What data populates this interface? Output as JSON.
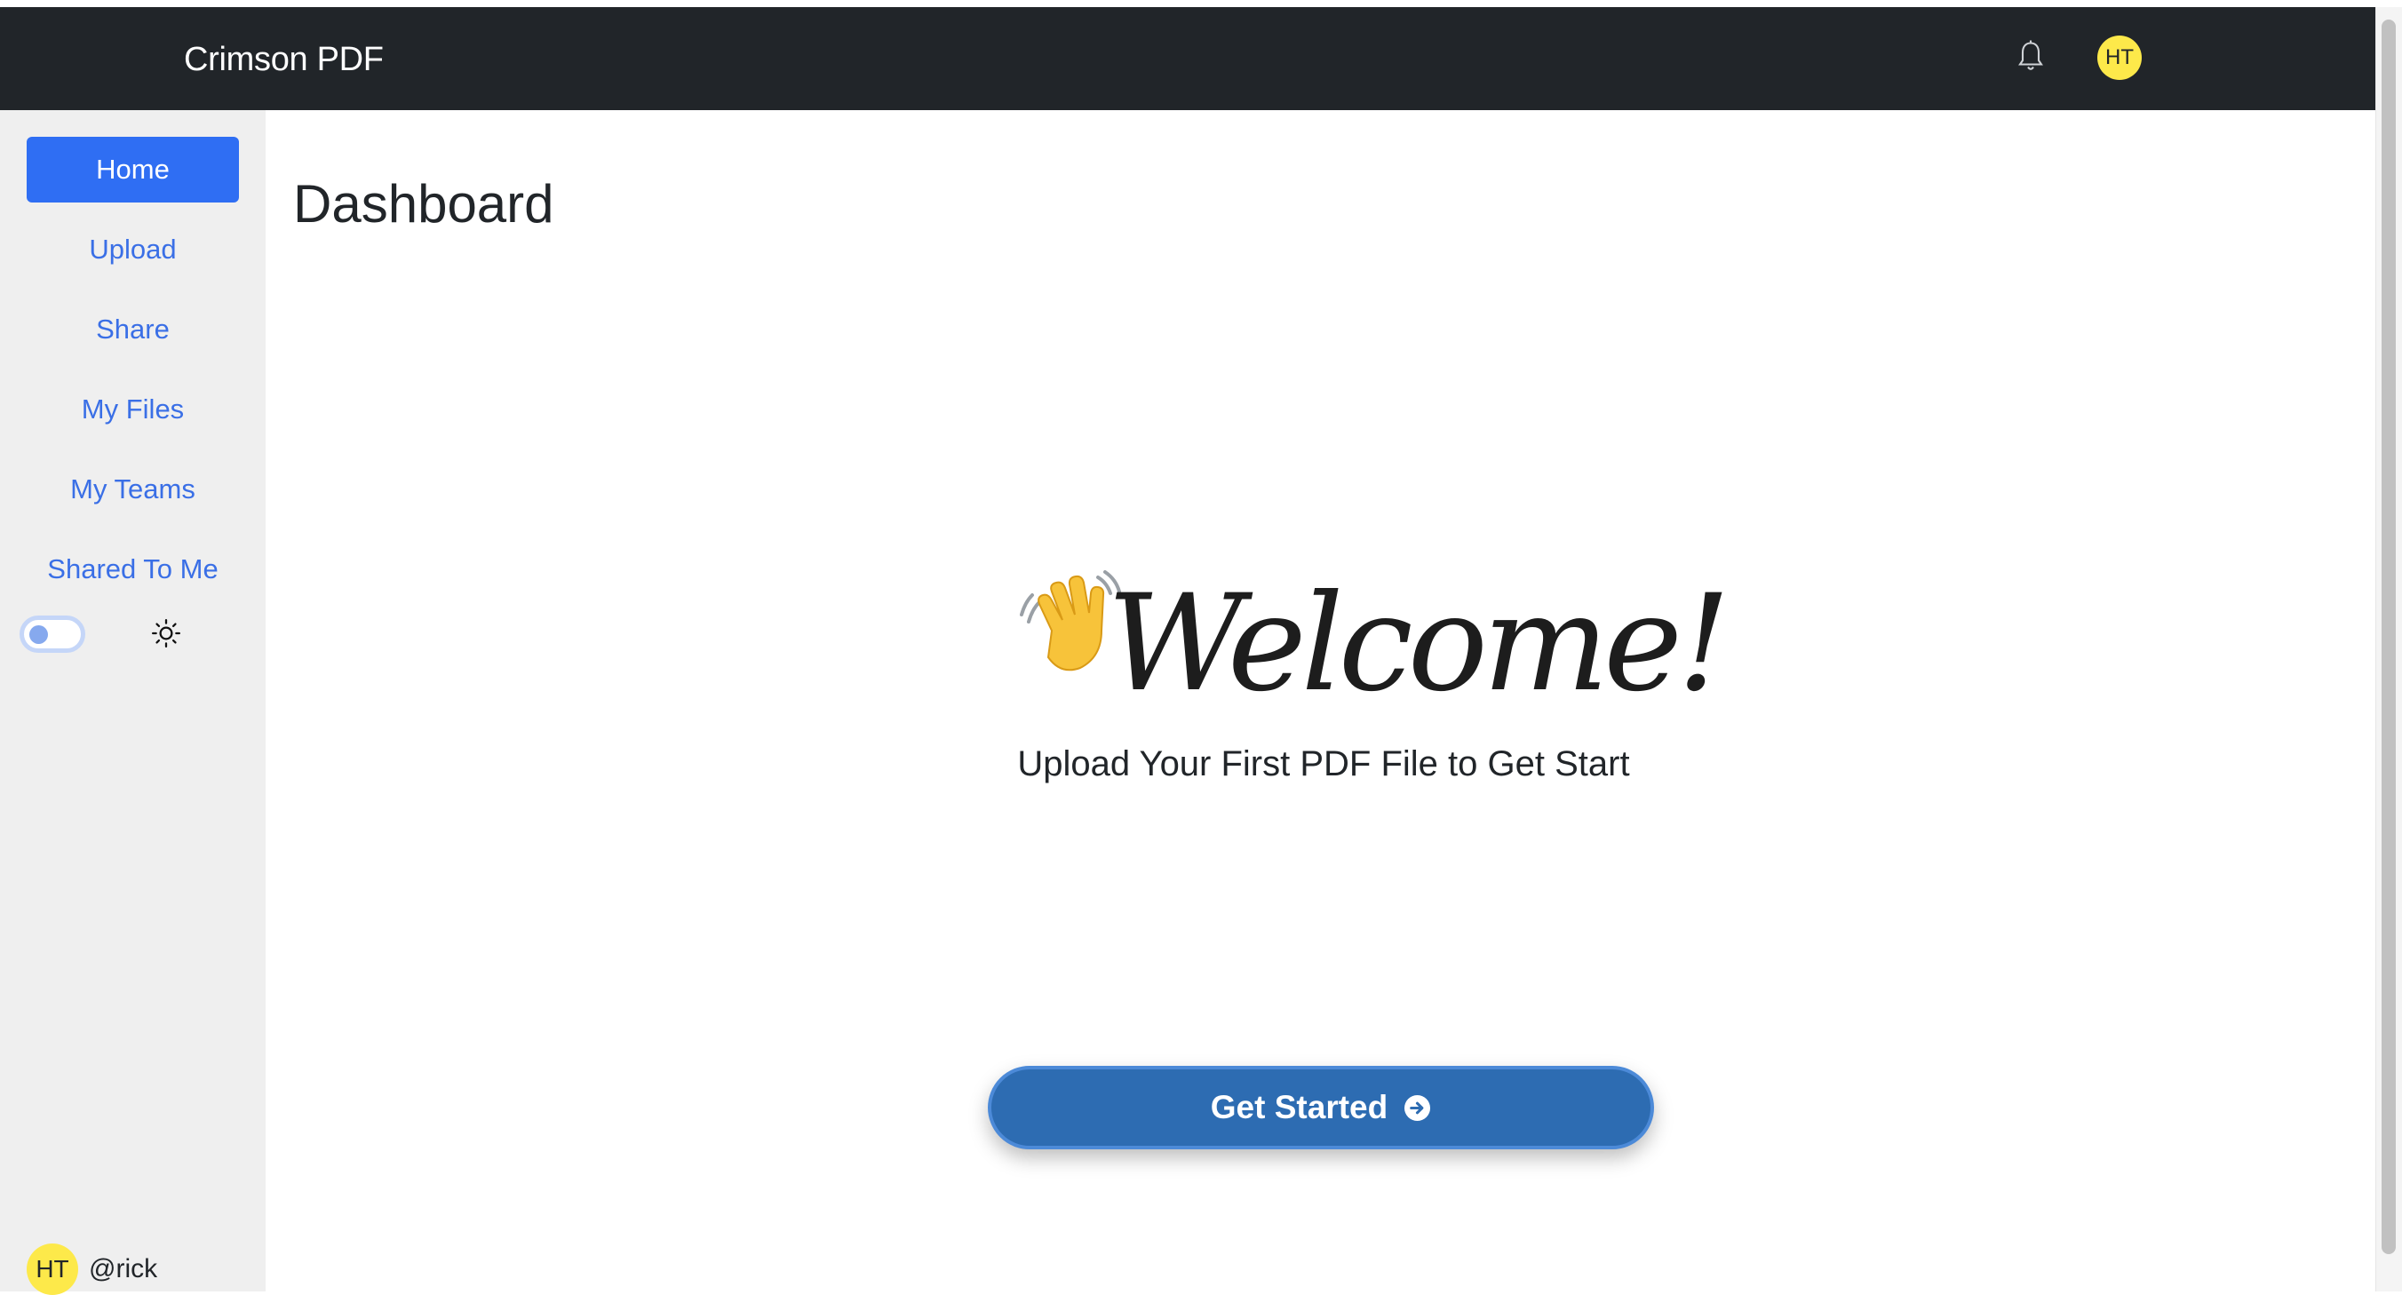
{
  "navbar": {
    "brand": "Crimson PDF",
    "bell_icon": "bell-icon",
    "avatar_initials": "HT"
  },
  "sidebar": {
    "items": [
      {
        "label": "Home",
        "active": true
      },
      {
        "label": "Upload",
        "active": false
      },
      {
        "label": "Share",
        "active": false
      },
      {
        "label": "My Files",
        "active": false
      },
      {
        "label": "My Teams",
        "active": false
      },
      {
        "label": "Shared To Me",
        "active": false
      }
    ],
    "theme_toggle": {
      "on": false,
      "icon": "sun-icon"
    },
    "user": {
      "initials": "HT",
      "username": "@rick"
    }
  },
  "main": {
    "title": "Dashboard",
    "welcome_icon": "waving-hand-icon",
    "welcome_text": "Welcome!",
    "subtitle": "Upload Your First PDF File to Get Start",
    "cta_label": "Get Started",
    "cta_icon": "arrow-right-circle-icon"
  },
  "colors": {
    "navbar_bg": "#212529",
    "sidebar_bg": "#efefef",
    "accent": "#2f6ef3",
    "link": "#3a6fe6",
    "cta_bg": "#2d6cb2",
    "avatar_bg": "#fde94a"
  }
}
